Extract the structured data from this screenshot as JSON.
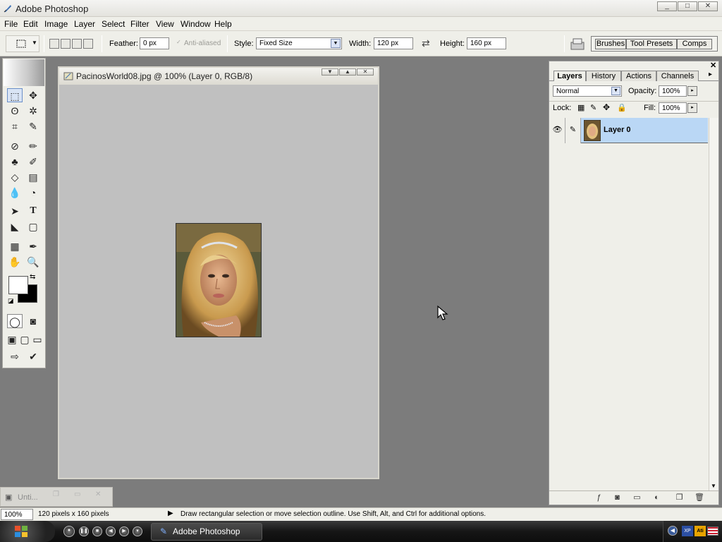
{
  "app": {
    "title": "Adobe Photoshop",
    "window_buttons": [
      "_",
      "□",
      "✕"
    ]
  },
  "menu": [
    "File",
    "Edit",
    "Image",
    "Layer",
    "Select",
    "Filter",
    "View",
    "Window",
    "Help"
  ],
  "options": {
    "feather_label": "Feather:",
    "feather_value": "0 px",
    "antialias_label": "Anti-aliased",
    "style_label": "Style:",
    "style_value": "Fixed Size",
    "width_label": "Width:",
    "width_value": "120 px",
    "height_label": "Height:",
    "height_value": "160 px",
    "well_tabs": [
      "Brushes",
      "Tool Presets",
      "Comps"
    ]
  },
  "document": {
    "title": "PacinosWorld08.jpg @ 100% (Layer 0, RGB/8)",
    "image_description_alt": ""
  },
  "layers_panel": {
    "tabs": [
      "Layers",
      "History",
      "Actions",
      "Channels"
    ],
    "active_tab": "Layers",
    "blend_mode": "Normal",
    "opacity_label": "Opacity:",
    "opacity_value": "100%",
    "lock_label": "Lock:",
    "fill_label": "Fill:",
    "fill_value": "100%",
    "layers": [
      {
        "name": "Layer 0",
        "visible": true,
        "selected": true
      }
    ]
  },
  "minimized_window": {
    "title": "Unti..."
  },
  "status": {
    "zoom": "100%",
    "doc_info": "120 pixels x 160 pixels",
    "hint": "Draw rectangular selection or move selection outline.  Use Shift, Alt, and Ctrl for additional options."
  },
  "taskbar": {
    "task_label": "Adobe Photoshop"
  },
  "colors": {
    "selection_highlight": "#bad7f5",
    "canvas_bg": "#7c7c7c",
    "doc_bg": "#c0c0c0"
  }
}
